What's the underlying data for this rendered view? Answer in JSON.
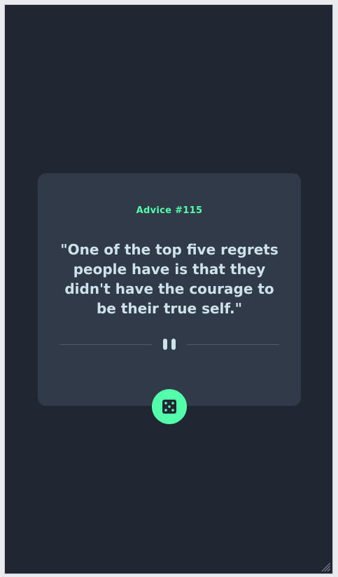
{
  "advice": {
    "label": "Advice #115",
    "text": "\"One of the top five regrets people have is that they didn't have the courage to be their true self.\""
  },
  "icons": {
    "divider": "pause-icon",
    "button": "dice-icon",
    "corner": "resize-grip-icon"
  },
  "colors": {
    "background": "#202733",
    "card": "#313a48",
    "accent": "#53ffaa",
    "text": "#cee3e9",
    "divider": "#4f5d74"
  }
}
